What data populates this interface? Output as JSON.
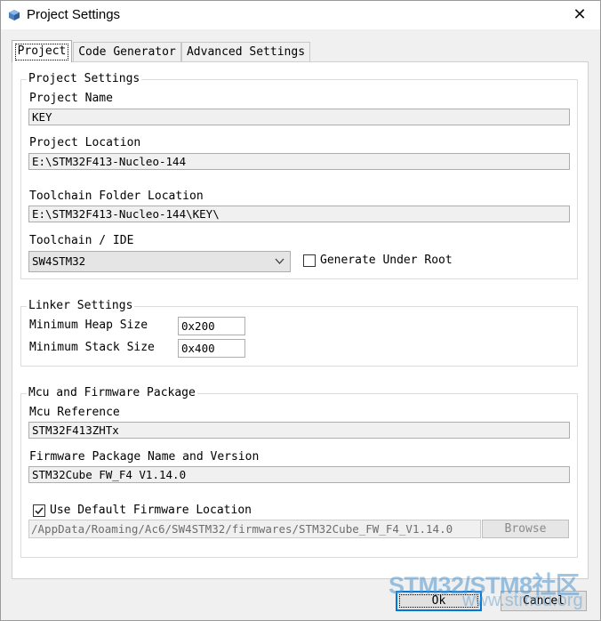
{
  "window": {
    "title": "Project Settings",
    "close_glyph": "✕"
  },
  "tabs": [
    {
      "label": "Project",
      "selected": true
    },
    {
      "label": "Code Generator",
      "selected": false
    },
    {
      "label": "Advanced Settings",
      "selected": false
    }
  ],
  "project_settings": {
    "legend": "Project Settings",
    "name_label": "Project Name",
    "name_value": "KEY",
    "location_label": "Project Location",
    "location_value": "E:\\STM32F413-Nucleo-144",
    "toolchain_folder_label": "Toolchain Folder Location",
    "toolchain_folder_value": "E:\\STM32F413-Nucleo-144\\KEY\\",
    "toolchain_label": "Toolchain / IDE",
    "toolchain_value": "SW4STM32",
    "generate_under_root_label": "Generate Under Root",
    "generate_under_root_checked": false
  },
  "linker_settings": {
    "legend": "Linker Settings",
    "heap_label": "Minimum Heap Size",
    "heap_value": "0x200",
    "stack_label": "Minimum Stack Size",
    "stack_value": "0x400"
  },
  "mcu_firmware": {
    "legend": "Mcu and Firmware Package",
    "mcu_label": "Mcu Reference",
    "mcu_value": "STM32F413ZHTx",
    "package_label": "Firmware Package Name and Version",
    "package_value": "STM32Cube FW_F4 V1.14.0",
    "use_default_label": "Use Default Firmware Location",
    "use_default_checked": true,
    "firmware_location_value": "/AppData/Roaming/Ac6/SW4STM32/firmwares/STM32Cube_FW_F4_V1.14.0",
    "browse_label": "Browse"
  },
  "footer": {
    "ok_label": "Ok",
    "cancel_label": "Cancel"
  },
  "watermark": {
    "text": "STM32/STM8社区",
    "url": "www.stmcu.org"
  },
  "colors": {
    "focus_border": "#0078d7",
    "app_icon": "#4a7fc1",
    "watermark": "#5096cd"
  }
}
